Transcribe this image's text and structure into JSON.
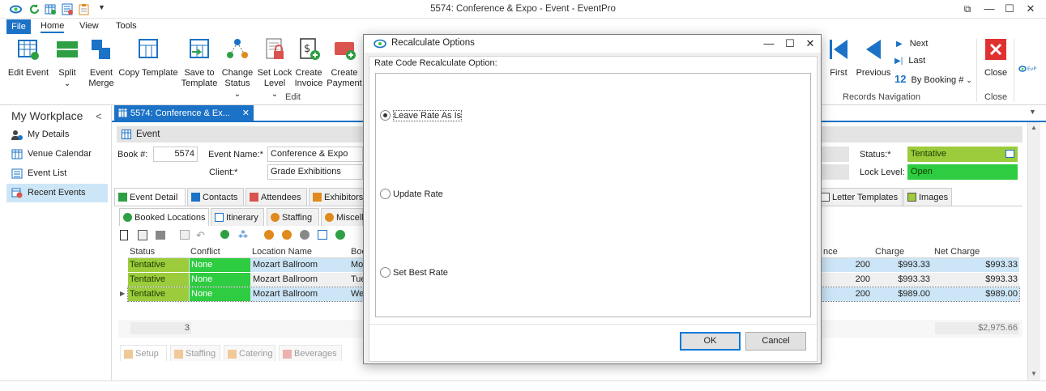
{
  "window": {
    "title": "5574: Conference & Expo - Event - EventPro",
    "quick_access": [
      "app-icon",
      "refresh-icon",
      "grid-icon",
      "report-icon",
      "clipboard-icon",
      "dropdown-arrow-icon"
    ],
    "controls": {
      "restore": "⧉",
      "minimize": "—",
      "maximize": "☐",
      "close": "✕"
    }
  },
  "menu": {
    "file": "File",
    "home": "Home",
    "view": "View",
    "tools": "Tools"
  },
  "ribbon": {
    "buttons": [
      {
        "label": "Edit Event",
        "icon": "edit-event-icon"
      },
      {
        "label": "Split",
        "icon": "split-icon",
        "arrow": "⌄"
      },
      {
        "label": "Event Merge",
        "icon": "merge-icon"
      },
      {
        "label": "Copy Template",
        "icon": "copy-template-icon"
      },
      {
        "label": "Save to Template",
        "icon": "save-template-icon"
      },
      {
        "label": "Change Status",
        "icon": "change-status-icon",
        "arrow": "⌄"
      },
      {
        "label": "Set Lock Level",
        "icon": "lock-icon",
        "arrow": "⌄"
      },
      {
        "label": "Create Invoice",
        "icon": "invoice-icon"
      },
      {
        "label": "Create Payment",
        "icon": "payment-icon"
      }
    ],
    "edit_group": "Edit",
    "nav": {
      "first": "First",
      "previous": "Previous",
      "next": "Next",
      "last": "Last",
      "by_booking": "By Booking #",
      "by_booking_num": "12",
      "group": "Records Navigation"
    },
    "close": {
      "label": "Close",
      "group": "Close"
    }
  },
  "sidebar": {
    "title": "My Workplace",
    "collapse": "<",
    "items": [
      {
        "label": "My Details",
        "icon": "user-info-icon"
      },
      {
        "label": "Venue Calendar",
        "icon": "calendar-icon"
      },
      {
        "label": "Event List",
        "icon": "list-icon"
      },
      {
        "label": "Recent Events",
        "icon": "recent-events-icon",
        "selected": true
      }
    ]
  },
  "doc_tab": "5574: Conference & Ex...",
  "event": {
    "section_title": "Event",
    "book_label": "Book #:",
    "book_value": "5574",
    "name_label": "Event Name:*",
    "name_value": "Conference & Expo",
    "client_label": "Client:*",
    "client_value": "Grade Exhibitions",
    "status_label": "Status:*",
    "status_value": "Tentative",
    "lock_label": "Lock Level:",
    "lock_value": "Open"
  },
  "tabs_main": [
    "Event Detail",
    "Contacts",
    "Attendees",
    "Exhibitors",
    "Letter Templates",
    "Images"
  ],
  "tabs_sub": [
    "Booked Locations",
    "Itinerary",
    "Staffing",
    "Miscell"
  ],
  "grid": {
    "headers": [
      "Status",
      "Conflict",
      "Location Name",
      "Boo",
      "nce",
      "Charge",
      "Net Charge"
    ],
    "rows": [
      {
        "status": "Tentative",
        "conflict": "None",
        "location": "Mozart Ballroom",
        "booking": "Mo",
        "attendance": "200",
        "charge": "$993.33",
        "net": "$993.33"
      },
      {
        "status": "Tentative",
        "conflict": "None",
        "location": "Mozart Ballroom",
        "booking": "Tue",
        "attendance": "200",
        "charge": "$993.33",
        "net": "$993.33"
      },
      {
        "status": "Tentative",
        "conflict": "None",
        "location": "Mozart Ballroom",
        "booking": "We",
        "attendance": "200",
        "charge": "$989.00",
        "net": "$989.00"
      }
    ],
    "footer_count": "3",
    "footer_total": "$2,975.66"
  },
  "lower_tabs": [
    "Setup",
    "Staffing",
    "Catering",
    "Beverages"
  ],
  "dialog": {
    "title": "Recalculate Options",
    "controls": {
      "minimize": "—",
      "maximize": "☐",
      "close": "✕"
    },
    "group_label": "Rate Code Recalculate Option:",
    "options": [
      {
        "label": "Leave Rate As Is",
        "selected": true
      },
      {
        "label": "Update Rate",
        "selected": false
      },
      {
        "label": "Set Best Rate",
        "selected": false
      }
    ],
    "ok": "OK",
    "cancel": "Cancel"
  },
  "colors": {
    "accent": "#1b72c6",
    "tentative": "#9ccc3c",
    "none": "#2ecc40",
    "open": "#2ecc40",
    "selected_row": "#cde6f7"
  }
}
